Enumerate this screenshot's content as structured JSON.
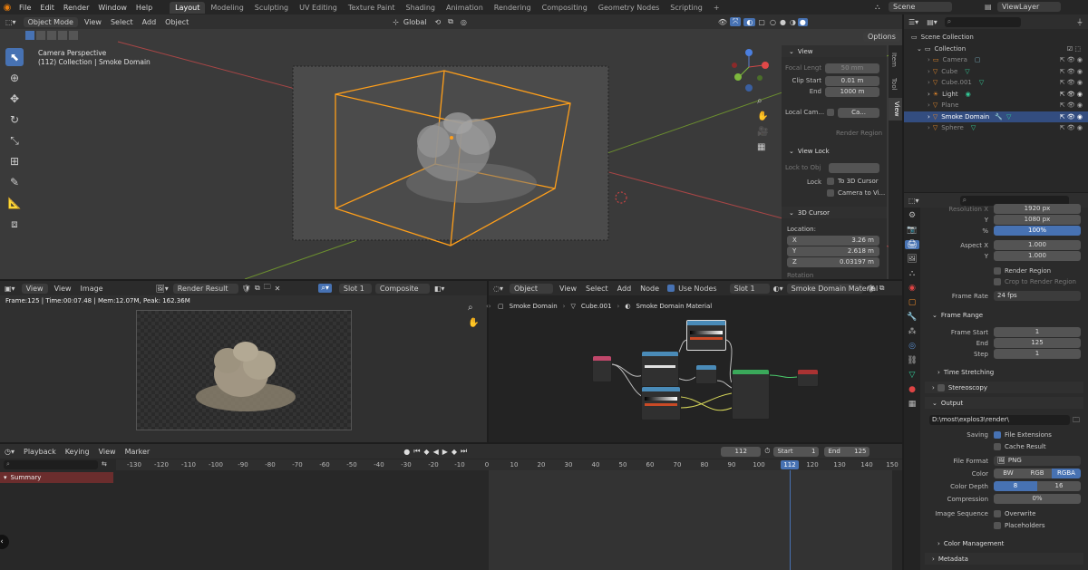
{
  "topbar": {
    "menus": [
      "File",
      "Edit",
      "Render",
      "Window",
      "Help"
    ],
    "workspaces": [
      "Layout",
      "Modeling",
      "Sculpting",
      "UV Editing",
      "Texture Paint",
      "Shading",
      "Animation",
      "Rendering",
      "Compositing",
      "Geometry Nodes",
      "Scripting"
    ],
    "active_workspace": "Layout",
    "add_tab": "+",
    "scene": "Scene",
    "view_layer": "ViewLayer"
  },
  "viewport": {
    "mode": "Object Mode",
    "menus": [
      "View",
      "Select",
      "Add",
      "Object"
    ],
    "orientation": "Global",
    "options": "Options",
    "camera_label": "Camera Perspective",
    "collection_label": "(112) Collection | Smoke Domain"
  },
  "npanel": {
    "tabs": [
      "Item",
      "Tool",
      "View"
    ],
    "view_header": "View",
    "focal_length_label": "Focal Lengt",
    "focal_length": "50 mm",
    "clip_start_label": "Clip Start",
    "clip_start": "0.01 m",
    "clip_end_label": "End",
    "clip_end": "1000 m",
    "local_camera_label": "Local Cam...",
    "local_camera_value": "Ca...",
    "render_region": "Render Region",
    "view_lock_header": "View Lock",
    "lock_to_obj_label": "Lock to Obj",
    "lock_label": "Lock",
    "to_3d_cursor": "To 3D Cursor",
    "camera_to_view": "Camera to Vi...",
    "cursor_header": "3D Cursor",
    "location_label": "Location:",
    "x_label": "X",
    "x": "3.26 m",
    "y_label": "Y",
    "y": "2.618 m",
    "z_label": "Z",
    "z": "0.03197 m",
    "rotation_label": "Rotation"
  },
  "outliner": {
    "scene_collection": "Scene Collection",
    "collection": "Collection",
    "items": [
      "Camera",
      "Cube",
      "Cube.001",
      "Light",
      "Plane",
      "Smoke Domain",
      "Sphere"
    ],
    "selected": "Smoke Domain"
  },
  "image_editor": {
    "menus": [
      "View",
      "View",
      "Image"
    ],
    "image_name": "Render Result",
    "slot": "Slot 1",
    "layer": "Composite",
    "stats": "Frame:125 | Time:00:07.48 | Mem:12.07M, Peak: 162.36M"
  },
  "node_editor": {
    "type": "Object",
    "menus": [
      "View",
      "Select",
      "Add",
      "Node"
    ],
    "use_nodes": "Use Nodes",
    "slot": "Slot 1",
    "material": "Smoke Domain Material",
    "breadcrumb": [
      "Smoke Domain",
      "Cube.001",
      "Smoke Domain Material"
    ]
  },
  "timeline": {
    "menus": [
      "Playback",
      "Keying",
      "View",
      "Marker"
    ],
    "current_frame": "112",
    "start_label": "Start",
    "start": "1",
    "end_label": "End",
    "end": "125",
    "summary": "Summary",
    "ticks": [
      "-130",
      "-120",
      "-110",
      "-100",
      "-90",
      "-80",
      "-70",
      "-60",
      "-50",
      "-40",
      "-30",
      "-20",
      "-10",
      "0",
      "10",
      "20",
      "30",
      "40",
      "50",
      "60",
      "70",
      "80",
      "90",
      "100",
      "112",
      "120",
      "130",
      "140",
      "150"
    ]
  },
  "properties": {
    "resolution_x_label": "Resolution X",
    "resolution_x": "1920 px",
    "resolution_y_label": "Y",
    "resolution_y": "1080 px",
    "percent_label": "%",
    "percent": "100%",
    "aspect_x_label": "Aspect X",
    "aspect_x": "1.000",
    "aspect_y_label": "Y",
    "aspect_y": "1.000",
    "render_region": "Render Region",
    "crop_region": "Crop to Render Region",
    "frame_rate_label": "Frame Rate",
    "frame_rate": "24 fps",
    "frame_range_header": "Frame Range",
    "frame_start_label": "Frame Start",
    "frame_start": "1",
    "frame_end_label": "End",
    "frame_end": "125",
    "frame_step_label": "Step",
    "frame_step": "1",
    "time_stretching": "Time Stretching",
    "stereoscopy": "Stereoscopy",
    "output_header": "Output",
    "output_path": "D:\\most\\explos3\\render\\",
    "saving_label": "Saving",
    "file_extensions": "File Extensions",
    "cache_result": "Cache Result",
    "file_format_label": "File Format",
    "file_format": "PNG",
    "color_label": "Color",
    "color_bw": "BW",
    "color_rgb": "RGB",
    "color_rgba": "RGBA",
    "color_depth_label": "Color Depth",
    "depth_8": "8",
    "depth_16": "16",
    "compression_label": "Compression",
    "compression": "0%",
    "image_sequence_label": "Image Sequence",
    "overwrite": "Overwrite",
    "placeholders": "Placeholders",
    "color_management": "Color Management",
    "metadata": "Metadata"
  },
  "colors": {
    "accent": "#4772b3",
    "selection": "#ff9f1a",
    "header": "#2b2b2b"
  }
}
